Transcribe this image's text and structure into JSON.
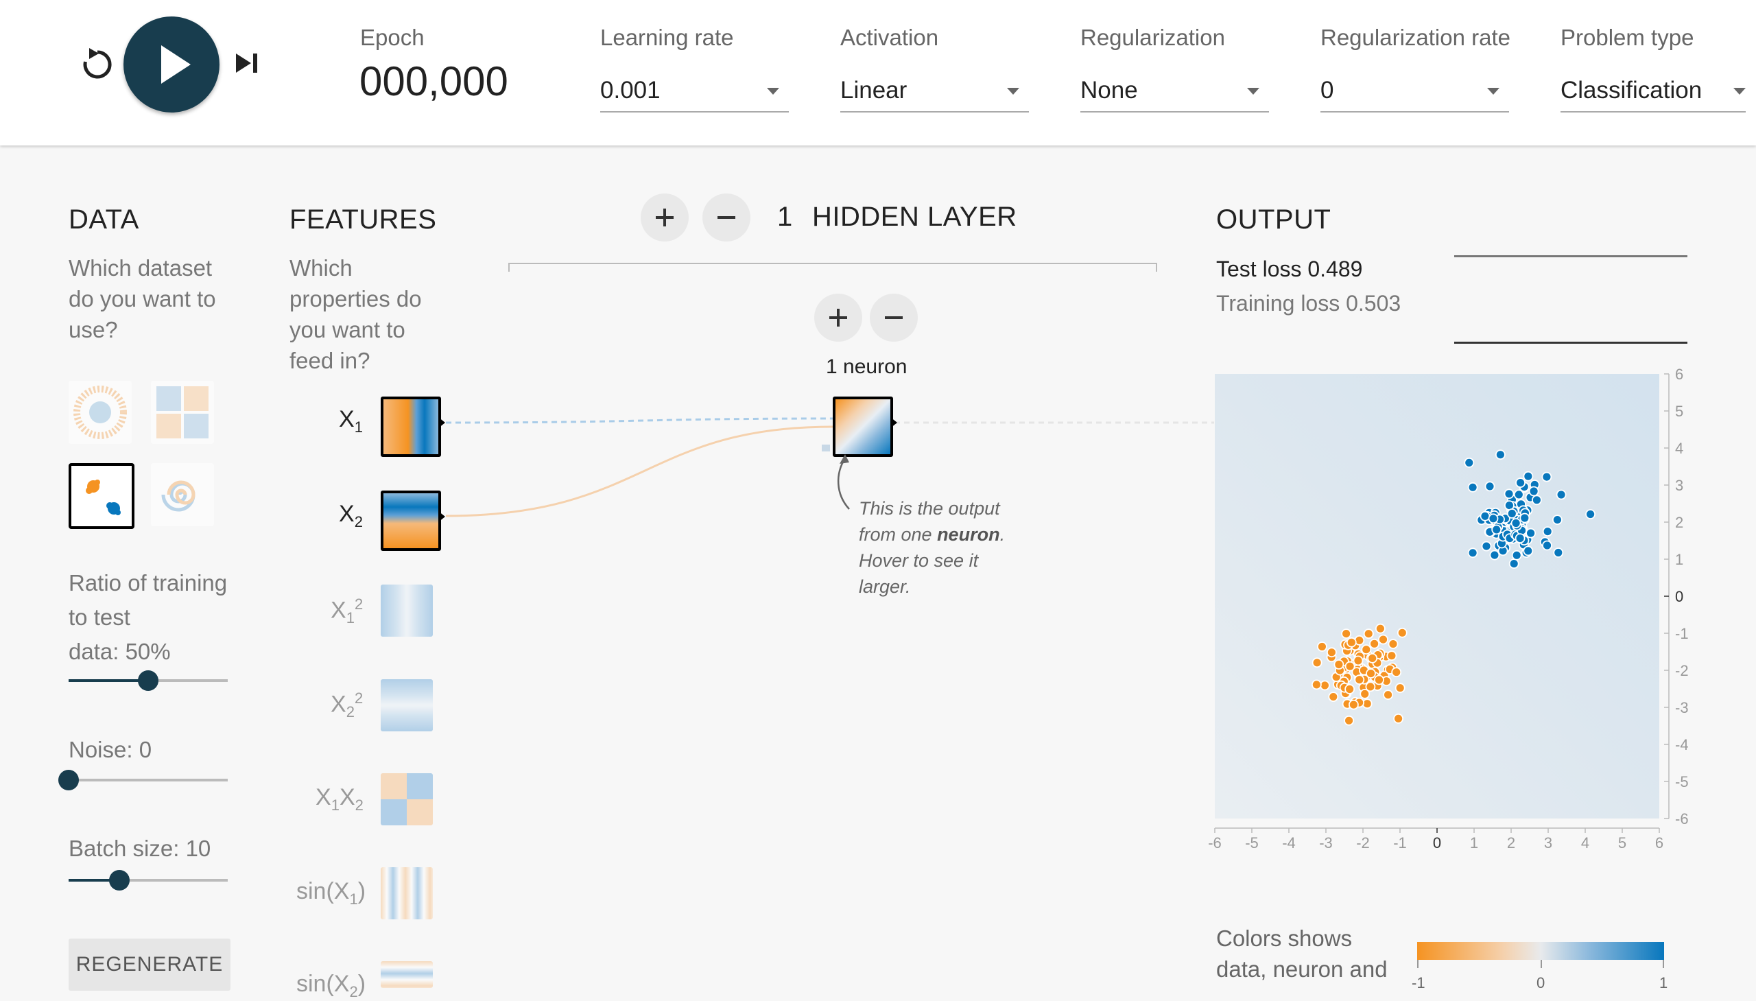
{
  "controls": {
    "epoch_label": "Epoch",
    "epoch_value": "000,000",
    "learning_rate_label": "Learning rate",
    "learning_rate_value": "0.001",
    "activation_label": "Activation",
    "activation_value": "Linear",
    "regularization_label": "Regularization",
    "regularization_value": "None",
    "regularization_rate_label": "Regularization rate",
    "regularization_rate_value": "0",
    "problem_type_label": "Problem type",
    "problem_type_value": "Classification"
  },
  "data_panel": {
    "heading": "DATA",
    "question_lines": [
      "Which dataset",
      "do you want to",
      "use?"
    ],
    "ratio_lines": [
      "Ratio of training",
      "to test"
    ],
    "ratio_value_text": "data:  50%",
    "ratio_fraction": 0.5,
    "noise_text": "Noise:  0",
    "noise_fraction": 0,
    "batch_text": "Batch size:  10",
    "batch_fraction": 0.32,
    "regenerate_label": "REGENERATE"
  },
  "features_panel": {
    "heading": "FEATURES",
    "question_lines": [
      "Which",
      "properties do",
      "you want to",
      "feed in?"
    ],
    "features": [
      {
        "base": "X",
        "sub": "1",
        "sup": "",
        "active": true
      },
      {
        "base": "X",
        "sub": "2",
        "sup": "",
        "active": true
      },
      {
        "base": "X",
        "sub": "1",
        "sup": "2",
        "active": false
      },
      {
        "base": "X",
        "sub": "2",
        "sup": "2",
        "active": false
      },
      {
        "base": "X",
        "sub": "1",
        "sup": "",
        "base2": "X",
        "sub2": "2",
        "active": false
      },
      {
        "base": "sin(X",
        "sub": "1",
        "tail": ")",
        "active": false
      },
      {
        "base": "sin(X",
        "sub": "2",
        "tail": ")",
        "active": false
      }
    ]
  },
  "network": {
    "layer_count": "1",
    "hidden_layer_label": "HIDDEN LAYER",
    "neuron_count_label": "1 neuron",
    "callout_lines": [
      "This is the output",
      "from one ",
      "neuron",
      ".",
      "Hover to see it",
      "larger."
    ]
  },
  "output_panel": {
    "heading": "OUTPUT",
    "test_loss": "Test loss 0.489",
    "training_loss": "Training loss 0.503",
    "legend_lines": [
      "Colors shows",
      "data, neuron and"
    ],
    "legend_ticks": [
      "-1",
      "0",
      "1"
    ]
  },
  "colors": {
    "accent_dark": "#183d4e",
    "orange": "#f59322",
    "blue": "#0877bd"
  },
  "chart_data": {
    "type": "scatter",
    "xlim": [
      -6,
      6
    ],
    "ylim": [
      -6,
      6
    ],
    "x_ticks": [
      "-6",
      "-5",
      "-4",
      "-3",
      "-2",
      "-1",
      "0",
      "1",
      "2",
      "3",
      "4",
      "5",
      "6"
    ],
    "y_ticks": [
      "6",
      "5",
      "4",
      "3",
      "2",
      "1",
      "0",
      "-1",
      "-2",
      "-3",
      "-4",
      "-5",
      "-6"
    ],
    "series": [
      {
        "color": "#0877bd",
        "center": [
          2,
          2
        ],
        "spread": 1.0,
        "count": 100
      },
      {
        "color": "#f59322",
        "center": [
          -2,
          -2
        ],
        "spread": 1.0,
        "count": 100
      }
    ]
  }
}
